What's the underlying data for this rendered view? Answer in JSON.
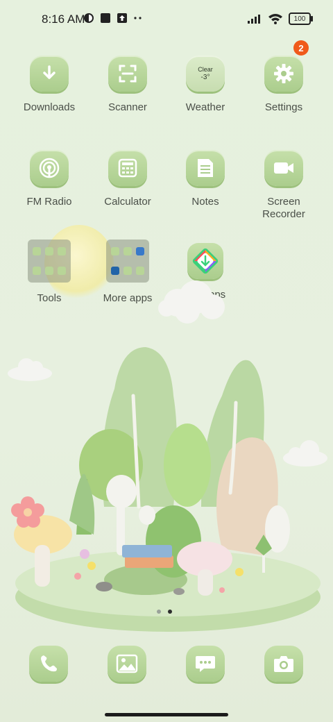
{
  "status_bar": {
    "time": "8:16 AM",
    "battery": "100"
  },
  "apps_row1": [
    {
      "label": "Downloads",
      "icon": "download-icon"
    },
    {
      "label": "Scanner",
      "icon": "scan-icon"
    },
    {
      "label": "Weather",
      "icon": "weather-icon",
      "tile_text": "Clear",
      "tile_value": "-3°"
    },
    {
      "label": "Settings",
      "icon": "gear-icon",
      "badge": "2"
    }
  ],
  "apps_row2": [
    {
      "label": "FM Radio",
      "icon": "radio-icon"
    },
    {
      "label": "Calculator",
      "icon": "calculator-icon"
    },
    {
      "label": "Notes",
      "icon": "notes-icon"
    },
    {
      "label": "Screen\nRecorder",
      "icon": "video-camera-icon"
    }
  ],
  "apps_row3": [
    {
      "label": "Tools",
      "type": "folder"
    },
    {
      "label": "More apps",
      "type": "folder"
    },
    {
      "label": "GetApps",
      "icon": "getapps-icon"
    }
  ],
  "dock": [
    {
      "name": "Phone",
      "icon": "phone-icon"
    },
    {
      "name": "Gallery",
      "icon": "gallery-icon"
    },
    {
      "name": "Messaging",
      "icon": "message-icon"
    },
    {
      "name": "Camera",
      "icon": "camera-icon"
    }
  ],
  "pages": {
    "count": 2,
    "active": 2
  },
  "colors": {
    "tile": "#b8d597",
    "badge": "#f05a1a",
    "background": "#e6f1de"
  }
}
